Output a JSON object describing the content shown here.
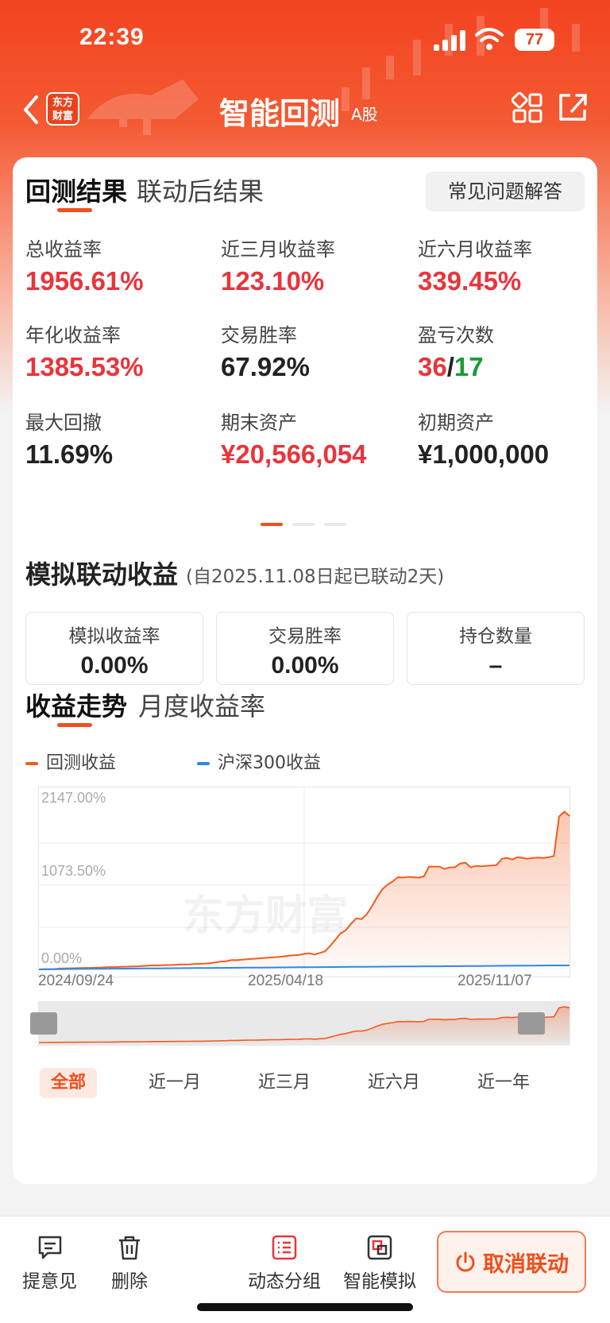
{
  "status_bar": {
    "time": "22:39",
    "battery": "77"
  },
  "nav": {
    "logo_text": "东方财富",
    "title": "智能回测",
    "subtitle": "A股"
  },
  "tabs": [
    {
      "label": "回测结果"
    },
    {
      "label": "联动后结果"
    }
  ],
  "faq_label": "常见问题解答",
  "metrics": [
    {
      "label": "总收益率",
      "value": "1956.61%",
      "color": "#e9343c"
    },
    {
      "label": "近三月收益率",
      "value": "123.10%",
      "color": "#e9343c"
    },
    {
      "label": "近六月收益率",
      "value": "339.45%",
      "color": "#e9343c"
    },
    {
      "label": "年化收益率",
      "value": "1385.53%",
      "color": "#e9343c"
    },
    {
      "label": "交易胜率",
      "value": "67.92%",
      "color": "#222222"
    },
    {
      "label": "盈亏次数",
      "wins": "36",
      "separator": "/",
      "losses": "17"
    },
    {
      "label": "最大回撤",
      "value": "11.69%",
      "color": "#222222"
    },
    {
      "label": "期末资产",
      "value": "¥20,566,054",
      "color": "#e9343c"
    },
    {
      "label": "初期资产",
      "value": "¥1,000,000",
      "color": "#222222"
    }
  ],
  "pager": {
    "count": 3,
    "active": 0
  },
  "sim": {
    "title": "模拟联动收益",
    "note": "(自2025.11.08日起已联动2天)",
    "boxes": [
      {
        "label": "模拟收益率",
        "value": "0.00%"
      },
      {
        "label": "交易胜率",
        "value": "0.00%"
      },
      {
        "label": "持仓数量",
        "value": "–"
      }
    ]
  },
  "trend_tabs": [
    {
      "label": "收益走势"
    },
    {
      "label": "月度收益率"
    }
  ],
  "watermark": "东方财富",
  "chart_data": {
    "type": "area",
    "series": [
      {
        "name": "回测收益",
        "color": "#f25c1e",
        "values": [
          0,
          2,
          3,
          5,
          11,
          13,
          14,
          15,
          17,
          19,
          20,
          23,
          24,
          28,
          29,
          30,
          34,
          35,
          38,
          40,
          45,
          48,
          52,
          52,
          55,
          56,
          58,
          62,
          64,
          65,
          70,
          72,
          75,
          80,
          90,
          100,
          104,
          118,
          117,
          124,
          130,
          135,
          140,
          145,
          150,
          155,
          158,
          165,
          175,
          180,
          185,
          200,
          205,
          190,
          210,
          230,
          300,
          380,
          460,
          500,
          580,
          650,
          640,
          700,
          800,
          920,
          1020,
          1080,
          1120,
          1175,
          1170,
          1180,
          1175,
          1170,
          1185,
          1310,
          1310,
          1310,
          1280,
          1300,
          1302,
          1350,
          1360,
          1300,
          1320,
          1315,
          1320,
          1325,
          1330,
          1410,
          1420,
          1400,
          1430,
          1420,
          1410,
          1420,
          1425,
          1420,
          1430,
          1445,
          1950,
          2010,
          1957
        ]
      },
      {
        "name": "沪深300收益",
        "color": "#2f88e8",
        "values": [
          0,
          1,
          2,
          3,
          3,
          4,
          5,
          5,
          6,
          6,
          7,
          7,
          8,
          8,
          9,
          9,
          10,
          10,
          11,
          11,
          12,
          12,
          13,
          13,
          14,
          14,
          15,
          15,
          16,
          16,
          17,
          17,
          18,
          18,
          19,
          19,
          20,
          20,
          21,
          21,
          22,
          22,
          23,
          23,
          24,
          24,
          25,
          25,
          26,
          26,
          27,
          27,
          28,
          28,
          29,
          29,
          30,
          30,
          31,
          31,
          32,
          32,
          33,
          33,
          34,
          34,
          35,
          35,
          36,
          36,
          37,
          37,
          38,
          38,
          39,
          39,
          40,
          40,
          41,
          41,
          42,
          42,
          43,
          43,
          44,
          44,
          45,
          45,
          46,
          46,
          47,
          47,
          48,
          48,
          49,
          49,
          50,
          50,
          51,
          51,
          51,
          51,
          52
        ]
      }
    ],
    "x_labels": [
      "2024/09/24",
      "2025/04/18",
      "2025/11/07"
    ],
    "y_ticks": [
      "2147.00%",
      "1073.50%",
      "0.00%"
    ],
    "ylim": [
      0,
      2147
    ],
    "grid": true,
    "legend_position": "top-left"
  },
  "periods": [
    {
      "label": "全部"
    },
    {
      "label": "近一月"
    },
    {
      "label": "近三月"
    },
    {
      "label": "近六月"
    },
    {
      "label": "近一年"
    }
  ],
  "bottom": {
    "items": [
      {
        "label": "提意见",
        "icon": "feedback-icon"
      },
      {
        "label": "删除",
        "icon": "trash-icon"
      },
      {
        "label": "动态分组",
        "icon": "list-icon"
      },
      {
        "label": "智能模拟",
        "icon": "simulate-icon"
      }
    ],
    "cancel_label": "取消联动"
  }
}
